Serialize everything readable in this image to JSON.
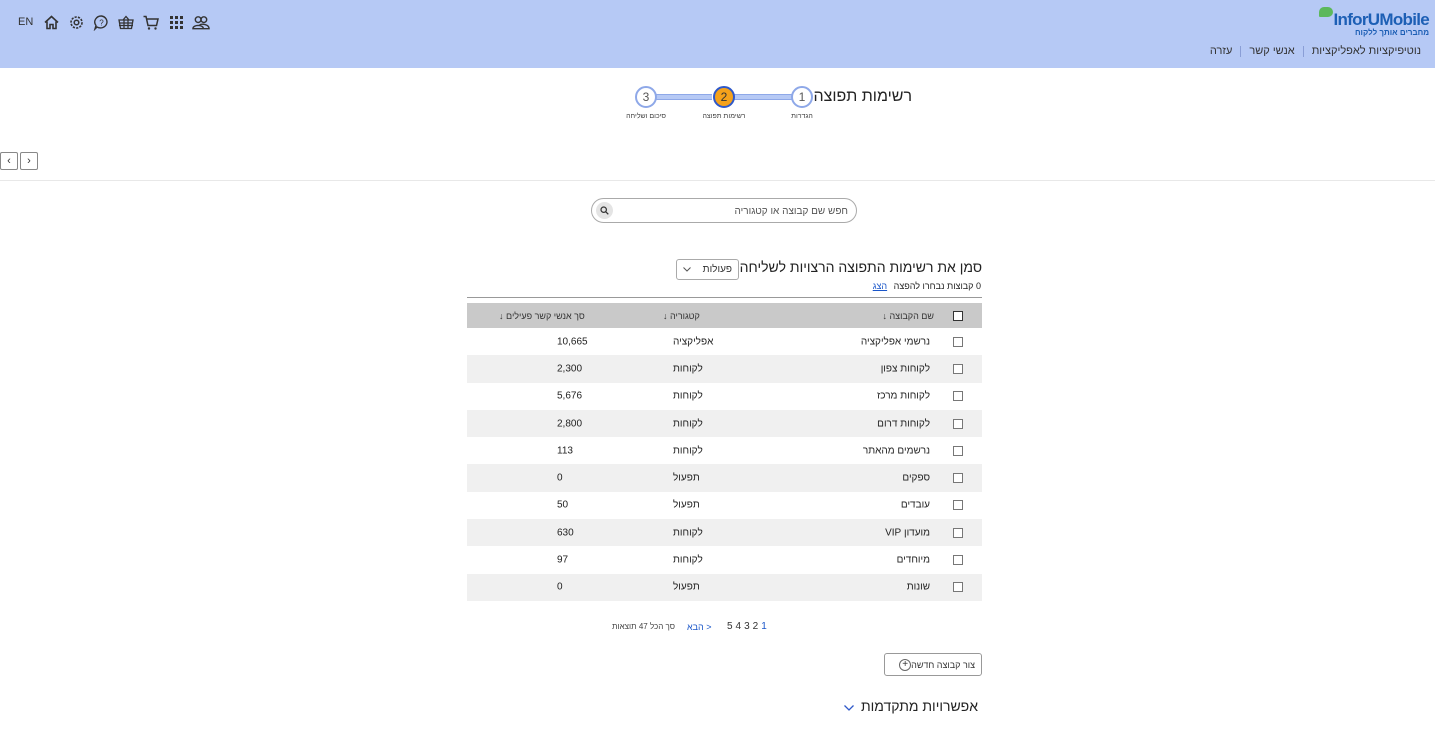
{
  "header": {
    "logo": {
      "brand": "InforUMobile",
      "tagline": "מחברים אותך ללקוח"
    },
    "nav": [
      {
        "label": "נוטיפיקציות לאפליקציות"
      },
      {
        "label": "אנשי קשר"
      },
      {
        "label": "עזרה"
      }
    ],
    "lang": "EN",
    "icons": [
      "contacts-icon",
      "apps-grid-icon",
      "cart-icon",
      "store-icon",
      "help-icon",
      "settings-icon",
      "home-icon"
    ],
    "bg_color": "#b6c9f5"
  },
  "wizard": {
    "title": "רשימות תפוצה",
    "steps": [
      {
        "num": "1",
        "label": "הגדרות"
      },
      {
        "num": "2",
        "label": "רשימות תפוצה"
      },
      {
        "num": "3",
        "label": "סיכום ושליחה"
      }
    ],
    "active_step": 2,
    "active_color": "#f5a21b"
  },
  "search": {
    "placeholder": "חפש שם קבוצה או קטגוריה"
  },
  "selection": {
    "title": "סמן את רשימות התפוצה הרצויות לשליחה",
    "actions_label": "פעולות",
    "selected_text": "0 קבוצות נבחרו להפצה",
    "show_link": "הצג"
  },
  "table": {
    "columns": {
      "name": "שם הקבוצה",
      "category": "קטגוריה",
      "count": "סך אנשי קשר פעילים"
    },
    "rows": [
      {
        "name": "נרשמי אפליקציה",
        "category": "אפליקציה",
        "count": "10,665"
      },
      {
        "name": "לקוחות צפון",
        "category": "לקוחות",
        "count": "2,300"
      },
      {
        "name": "לקוחות מרכז",
        "category": "לקוחות",
        "count": "5,676"
      },
      {
        "name": "לקוחות דרום",
        "category": "לקוחות",
        "count": "2,800"
      },
      {
        "name": "נרשמים מהאתר",
        "category": "לקוחות",
        "count": "113"
      },
      {
        "name": "ספקים",
        "category": "תפעול",
        "count": "0"
      },
      {
        "name": "עובדים",
        "category": "תפעול",
        "count": "50"
      },
      {
        "name": "מועדון VIP",
        "category": "לקוחות",
        "count": "630"
      },
      {
        "name": "מיוחדים",
        "category": "לקוחות",
        "count": "97"
      },
      {
        "name": "שונות",
        "category": "תפעול",
        "count": "0"
      }
    ]
  },
  "pagination": {
    "total_text": "סך הכל 47 תוצאות",
    "next_label": "הבא >",
    "pages": [
      "5",
      "4",
      "3",
      "2",
      "1"
    ],
    "current": "1"
  },
  "new_group_label": "צור קבוצה חדשה",
  "advanced_label": "אפשרויות מתקדמות"
}
